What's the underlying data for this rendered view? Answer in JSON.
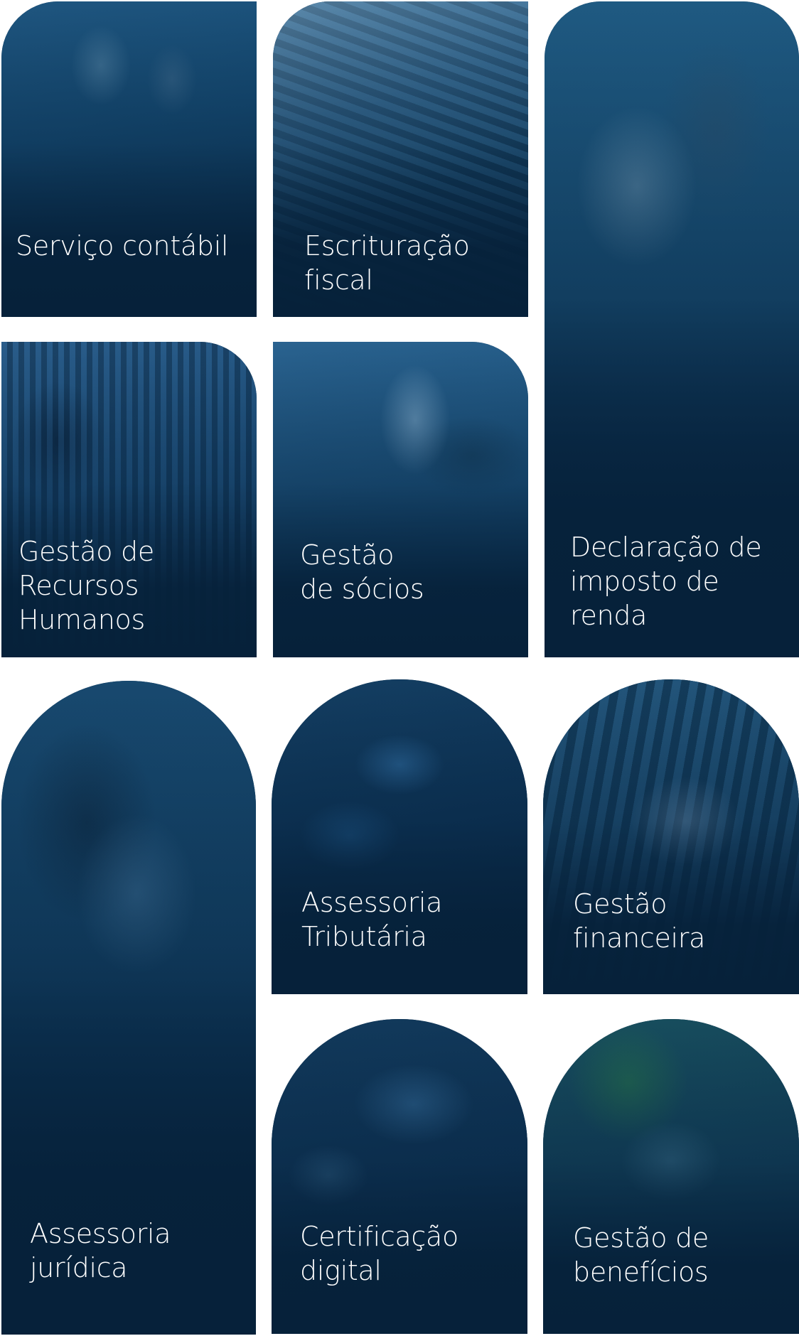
{
  "services": [
    {
      "id": "servico-contabil",
      "label": "Serviço contábil"
    },
    {
      "id": "escrituracao-fiscal",
      "label": "Escrituração\nfiscal"
    },
    {
      "id": "declaracao-imposto-renda",
      "label": "Declaração de\nimposto de\nrenda"
    },
    {
      "id": "gestao-recursos-humanos",
      "label": "Gestão de\nRecursos\nHumanos"
    },
    {
      "id": "gestao-socios",
      "label": "Gestão\nde sócios"
    },
    {
      "id": "assessoria-juridica",
      "label": "Assessoria\njurídica"
    },
    {
      "id": "assessoria-tributaria",
      "label": "Assessoria\nTributária"
    },
    {
      "id": "gestao-financeira",
      "label": "Gestão\nfinanceira"
    },
    {
      "id": "certificacao-digital",
      "label": "Certificação\ndigital"
    },
    {
      "id": "gestao-beneficios",
      "label": "Gestão de\nbenefícios"
    }
  ],
  "colors": {
    "overlay": "#0c2d4c",
    "text": "#ffffff",
    "background": "#ffffff"
  }
}
